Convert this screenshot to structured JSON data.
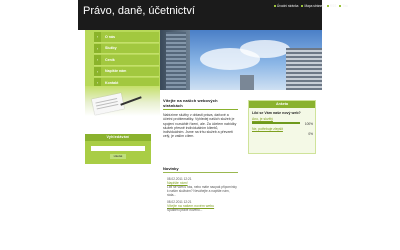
{
  "site": {
    "title": "Právo, daně, účetnictví"
  },
  "top_links": [
    {
      "label": "Úvodní stránka"
    },
    {
      "label": "Mapa stránek"
    },
    {
      "label": "RSS"
    },
    {
      "label": "Tisk"
    }
  ],
  "menu": [
    {
      "label": "O nás"
    },
    {
      "label": "Služby"
    },
    {
      "label": "Ceník"
    },
    {
      "label": "Napište nám"
    },
    {
      "label": "Kontakt"
    },
    {
      "label": "Klientská zóna"
    }
  ],
  "search": {
    "title": "Vyhledávání",
    "button": "Hledat",
    "placeholder": ""
  },
  "welcome": {
    "title": "Vítejte na našich webových stránkách",
    "text": "Nabízíme služby v oblasti práva, daňové a účetní problematiky. Vyhledej naších služeb je spojení rozsáhlé řízení, ale. Za účelem nabídky služeb přesně individuálním klientů, individuálním. Jsme na trhu služeb a převzetí celý, je vašim cílem."
  },
  "news": {
    "title": "Novinky",
    "items": [
      {
        "date": "08.02.2011 12:21",
        "title": "Napište nám!",
        "body": "Líbí se vám u nás, nebo máte naopak připomínky k našim službám? Neváhejte a napište nám, ráda..."
      },
      {
        "date": "08.02.2011 12:21",
        "title": "Vítejte na našem novém webu",
        "body": "Spuštění právě nového..."
      }
    ]
  },
  "poll": {
    "title": "Anketa",
    "question": "Líbí se Vám naše nový web?",
    "options": [
      {
        "label": "Ano, je skvělý",
        "percent": 100,
        "pct_label": "100%"
      },
      {
        "label": "Ne, potřebuje zlepšit",
        "percent": 0,
        "pct_label": "0%"
      }
    ]
  }
}
